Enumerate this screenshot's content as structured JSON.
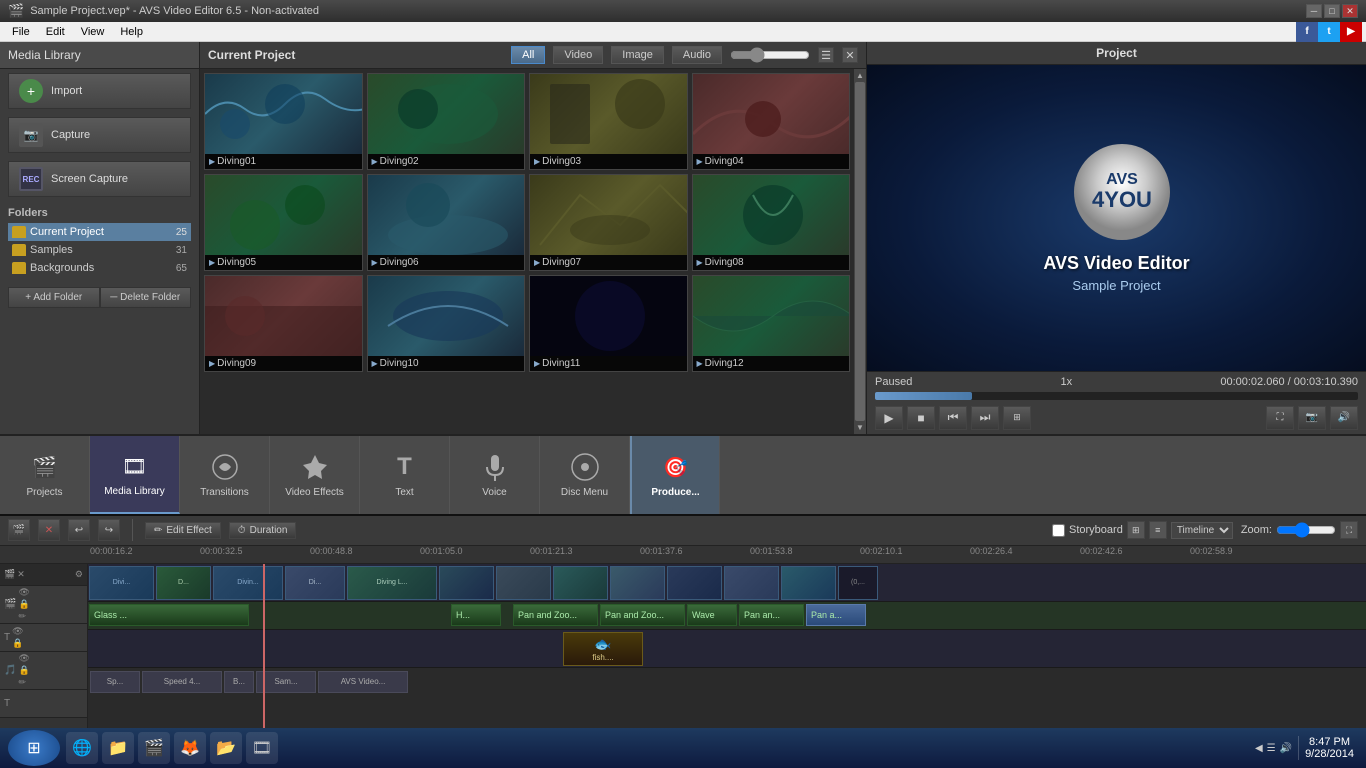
{
  "app": {
    "title": "Sample Project.vep* - AVS Video Editor 6.5 - Non-activated",
    "min_btn": "─",
    "max_btn": "□",
    "close_btn": "✕"
  },
  "menu": {
    "items": [
      "File",
      "Edit",
      "View",
      "Help"
    ]
  },
  "social": {
    "fb": "f",
    "tw": "t",
    "yt": "▶"
  },
  "left_panel": {
    "title": "Media Library",
    "import_btn": "Import",
    "capture_btn": "Capture",
    "screen_capture_btn": "Screen Capture",
    "folders_title": "Folders",
    "folders": [
      {
        "name": "Current Project",
        "count": "25",
        "active": true
      },
      {
        "name": "Samples",
        "count": "31",
        "active": false
      },
      {
        "name": "Backgrounds",
        "count": "65",
        "active": false
      }
    ],
    "add_folder_btn": "+ Add Folder",
    "delete_folder_btn": "─ Delete Folder"
  },
  "project_panel": {
    "title": "Current Project",
    "filters": [
      "All",
      "Video",
      "Image",
      "Audio"
    ],
    "active_filter": "All",
    "media_items": [
      {
        "label": "Diving01",
        "color_class": "thumb-color-1"
      },
      {
        "label": "Diving02",
        "color_class": "thumb-color-2"
      },
      {
        "label": "Diving03",
        "color_class": "thumb-color-3"
      },
      {
        "label": "Diving04",
        "color_class": "thumb-color-4"
      },
      {
        "label": "Diving05",
        "color_class": "thumb-color-2"
      },
      {
        "label": "Diving06",
        "color_class": "thumb-color-3"
      },
      {
        "label": "Diving07",
        "color_class": "thumb-color-1"
      },
      {
        "label": "Diving08",
        "color_class": "thumb-color-2"
      },
      {
        "label": "Diving09",
        "color_class": "thumb-color-4"
      },
      {
        "label": "Diving10",
        "color_class": "thumb-color-1"
      },
      {
        "label": "Diving11",
        "color_class": "thumb-color-3"
      },
      {
        "label": "Diving12",
        "color_class": "thumb-color-2"
      }
    ]
  },
  "preview": {
    "title": "Project",
    "app_name": "AVS Video Editor",
    "app_subtitle": "Sample Project",
    "avs_text": "AVS",
    "four_you_text": "4YOU",
    "status": "Paused",
    "speed": "1x",
    "time_current": "00:00:02.060",
    "time_total": "00:03:10.390",
    "time_separator": "/"
  },
  "toolbar": {
    "items": [
      {
        "label": "Projects",
        "icon": "🎬"
      },
      {
        "label": "Media Library",
        "icon": "🎞"
      },
      {
        "label": "Transitions",
        "icon": "⚙"
      },
      {
        "label": "Video Effects",
        "icon": "✨"
      },
      {
        "label": "Text",
        "icon": "T"
      },
      {
        "label": "Voice",
        "icon": "🎙"
      },
      {
        "label": "Disc Menu",
        "icon": "💿"
      },
      {
        "label": "Produce...",
        "icon": "🎯"
      }
    ],
    "active_index": 1
  },
  "timeline": {
    "edit_effect_btn": "Edit Effect",
    "duration_btn": "Duration",
    "storyboard_label": "Storyboard",
    "zoom_label": "Zoom:",
    "ruler_marks": [
      "00:00:16.2",
      "00:00:32.5",
      "00:00:48.8",
      "00:01:05.0",
      "00:01:21.3",
      "00:01:37.6",
      "00:01:53.8",
      "00:02:10.1",
      "00:02:26.4",
      "00:02:42.6",
      "00:02:58.9"
    ],
    "video_clips": [
      "Divi...",
      "D...",
      "Divin...",
      "Di...",
      "Diving L...",
      "",
      "",
      "",
      "",
      "",
      "",
      "",
      "(0,..."
    ],
    "text_clips": [
      "Glass ...",
      "H...",
      "Pan and Zoo...",
      "Pan and Zoo...",
      "Wave",
      "Pan an...",
      "Pan a..."
    ],
    "audio_clips": [
      "fish...."
    ],
    "bottom_clips": [
      "Sp...",
      "Speed 4...",
      "B...",
      "Sam...",
      "AVS Video..."
    ]
  },
  "taskbar": {
    "icons": [
      "🌐",
      "📁",
      "🎬",
      "🦊",
      "📂",
      "🎞"
    ],
    "clock": "8:47 PM",
    "date": "9/28/2014",
    "systray": "◀ ☰ 🔊"
  }
}
